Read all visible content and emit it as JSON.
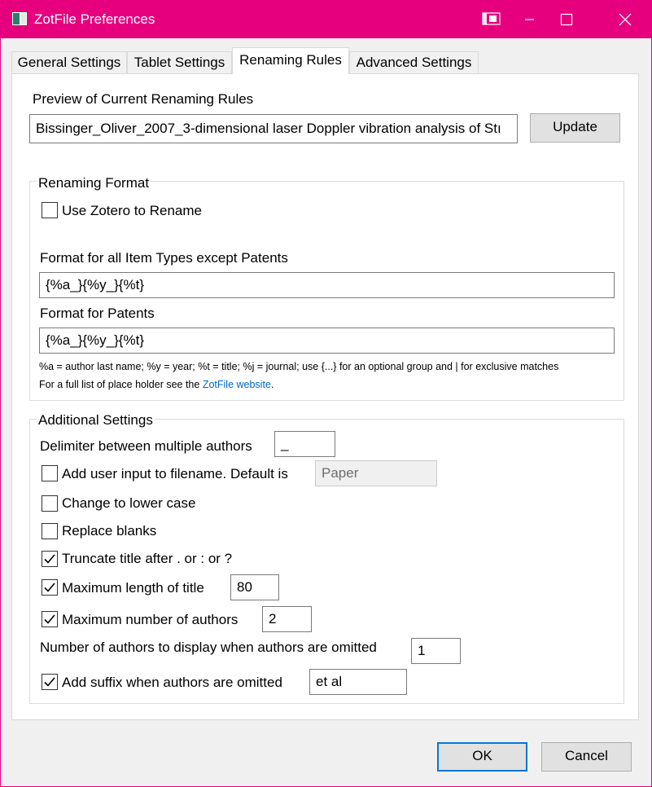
{
  "window": {
    "title": "ZotFile Preferences",
    "accent_color": "#e6007e"
  },
  "tabs": [
    {
      "label": "General Settings",
      "active": false
    },
    {
      "label": "Tablet Settings",
      "active": false
    },
    {
      "label": "Renaming Rules",
      "active": true
    },
    {
      "label": "Advanced Settings",
      "active": false
    }
  ],
  "preview": {
    "heading": "Preview of Current Renaming Rules",
    "value": "Bissinger_Oliver_2007_3-dimensional laser Doppler vibration analysis of Stı",
    "update_label": "Update"
  },
  "renaming_format": {
    "caption": "Renaming Format",
    "use_zotero": {
      "label": "Use Zotero to Rename",
      "checked": false
    },
    "format_all_label": "Format for all Item Types except Patents",
    "format_all_value": "{%a_}{%y_}{%t}",
    "format_patents_label": "Format for Patents",
    "format_patents_value": "{%a_}{%y_}{%t}",
    "hint1": "%a = author last name; %y = year; %t = title; %j = journal; use {...} for an optional group and | for exclusive matches",
    "hint2_prefix": "For a full list of place holder see the ",
    "hint2_link": "ZotFile website",
    "hint2_suffix": "."
  },
  "additional": {
    "caption": "Additional Settings",
    "delimiter_label": "Delimiter between multiple authors",
    "delimiter_value": "_",
    "user_input": {
      "label": "Add user input to filename. Default is",
      "checked": false,
      "value": "Paper"
    },
    "lower_case": {
      "label": "Change to lower case",
      "checked": false
    },
    "replace_blanks": {
      "label": "Replace blanks",
      "checked": false
    },
    "truncate_title": {
      "label": "Truncate title after . or : or ?",
      "checked": true
    },
    "max_title_length": {
      "label": "Maximum length of title",
      "checked": true,
      "value": "80"
    },
    "max_authors": {
      "label": "Maximum number of authors",
      "checked": true,
      "value": "2"
    },
    "display_authors_label": "Number of authors to display when authors are omitted",
    "display_authors_value": "1",
    "add_suffix": {
      "label": "Add suffix when authors are omitted",
      "checked": true,
      "value": "et al"
    }
  },
  "footer": {
    "ok_label": "OK",
    "cancel_label": "Cancel"
  }
}
